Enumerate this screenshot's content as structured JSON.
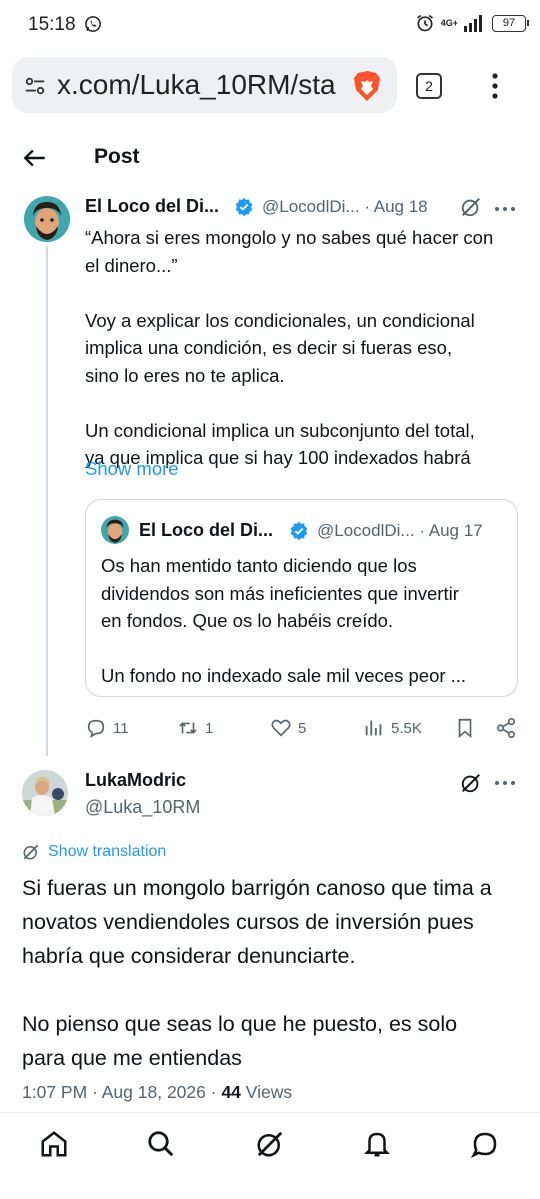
{
  "status_bar": {
    "time": "15:18",
    "network": "4G+",
    "battery": "97"
  },
  "browser": {
    "url": "x.com/Luka_10RM/sta",
    "tab_count": "2"
  },
  "header": {
    "title": "Post"
  },
  "tweet": {
    "author_name": "El Loco del Di...",
    "author_handle": "@LocodlDi...",
    "date": "· Aug 18",
    "lines": [
      "“Ahora si eres mongolo y no sabes qué hacer con",
      "el dinero...”",
      "",
      "Voy a explicar los condicionales, un condicional",
      "implica una condición, es decir si fueras eso,",
      "sino lo eres no te aplica.",
      "",
      "Un condicional implica un subconjunto del total,",
      "ya que implica que si hay 100 indexados habrá"
    ],
    "show_more": "Show more",
    "quote": {
      "author_name": "El Loco del Di...",
      "author_handle": "@LocodlDi...",
      "date": "· Aug 17",
      "lines": [
        "Os han mentido tanto diciendo que los",
        "dividendos son más ineficientes que invertir",
        "en fondos. Que os lo habéis creído.",
        "",
        "Un fondo no indexado sale mil veces peor ..."
      ]
    },
    "actions": {
      "replies": "11",
      "reposts": "1",
      "likes": "5",
      "views": "5.5K"
    }
  },
  "reply": {
    "author_name": "LukaModric",
    "author_handle": "@Luka_10RM",
    "translation_label": "Show translation",
    "lines": [
      "Si fueras un mongolo barrigón canoso que tima a",
      "novatos vendiendoles cursos de inversión pues",
      "habría que considerar denunciarte.",
      "",
      "No pienso que seas lo que he puesto, es solo",
      "para que me entiendas"
    ],
    "timestamp": "1:07 PM · Aug 18, 2026 ·",
    "views_count": "44",
    "views_label": "Views"
  },
  "colors": {
    "accent": "#1d9bf0",
    "text_primary": "#0f1419",
    "text_secondary": "#536471",
    "brave": "#fb542b"
  },
  "icons": [
    "whatsapp-icon",
    "alarm-icon",
    "signal-icon",
    "battery-icon",
    "site-settings-icon",
    "brave-icon",
    "tabs-icon",
    "menu-icon",
    "back-icon",
    "verified-icon",
    "grok-icon",
    "more-icon",
    "reply-icon",
    "repost-icon",
    "like-icon",
    "views-icon",
    "bookmark-icon",
    "share-icon",
    "translate-icon",
    "home-icon",
    "search-icon",
    "notifications-icon",
    "messages-icon"
  ]
}
